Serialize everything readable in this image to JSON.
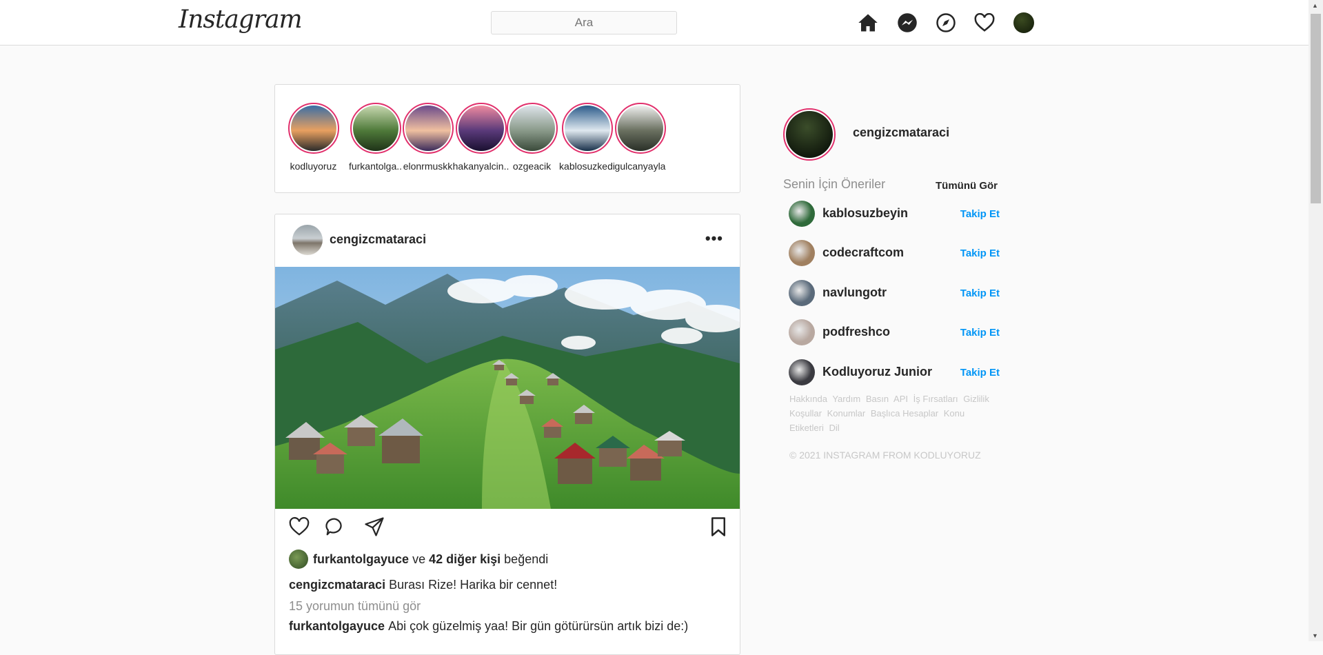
{
  "nav": {
    "logo": "Instagram",
    "search_placeholder": "Ara",
    "icons": [
      "home-icon",
      "messenger-icon",
      "explore-icon",
      "heart-icon",
      "profile-avatar"
    ]
  },
  "stories": [
    {
      "name": "kodluyoruz",
      "colors": [
        "#3a6ea5",
        "#e8a060",
        "#2b2b2b"
      ]
    },
    {
      "name": "furkantolga..",
      "colors": [
        "#c8d8b0",
        "#4f7a3a",
        "#1f3318"
      ]
    },
    {
      "name": "elonrmuskk",
      "colors": [
        "#6a4a8a",
        "#f0c0a0",
        "#3a2a5a"
      ]
    },
    {
      "name": "hakanyalcin..",
      "colors": [
        "#f08aa0",
        "#5a3a7a",
        "#1a1030"
      ]
    },
    {
      "name": "ozgeacik",
      "colors": [
        "#dde4ea",
        "#8a9a8a",
        "#3a4a3a"
      ]
    },
    {
      "name": "kablosuzkedi",
      "colors": [
        "#2a5a8a",
        "#dfe8ef",
        "#18304a"
      ]
    },
    {
      "name": "gulcanyayla",
      "colors": [
        "#f0f0f0",
        "#6a7060",
        "#2a3028"
      ]
    }
  ],
  "post": {
    "username": "cengizcmataraci",
    "more": "•••",
    "liked_by_user": "furkantolgayuce",
    "liked_connector": "ve",
    "liked_others": "42 diğer kişi",
    "liked_suffix": "beğendi",
    "caption_user": "cengizcmataraci",
    "caption_text": "Burası Rize! Harika bir cennet!",
    "view_comments": "15 yorumun tümünü gör",
    "comment_user": "furkantolgayuce",
    "comment_text": "Abi çok güzelmiş yaa! Bir gün götürürsün artık bizi de:)"
  },
  "sidebar": {
    "username": "cengizcmataraci",
    "suggestions_title": "Senin İçin Öneriler",
    "see_all": "Tümünü Gör",
    "suggestions": [
      {
        "name": "kablosuzbeyin",
        "follow": "Takip Et",
        "color": "#2f6a3a"
      },
      {
        "name": "codecraftcom",
        "follow": "Takip Et",
        "color": "#a08060"
      },
      {
        "name": "navlungotr",
        "follow": "Takip Et",
        "color": "#5a6a7a"
      },
      {
        "name": "podfreshco",
        "follow": "Takip Et",
        "color": "#b8a8a0"
      },
      {
        "name": "Kodluyoruz Junior",
        "follow": "Takip Et",
        "color": "#3a3a40"
      }
    ],
    "footer_links": [
      "Hakkında",
      "Yardım",
      "Basın",
      "API",
      "İş Fırsatları",
      "Gizlilik",
      "Koşullar",
      "Konumlar",
      "Başlıca Hesaplar",
      "Konu Etiketleri",
      "Dil"
    ],
    "copyright": "© 2021 INSTAGRAM FROM KODLUYORUZ"
  }
}
